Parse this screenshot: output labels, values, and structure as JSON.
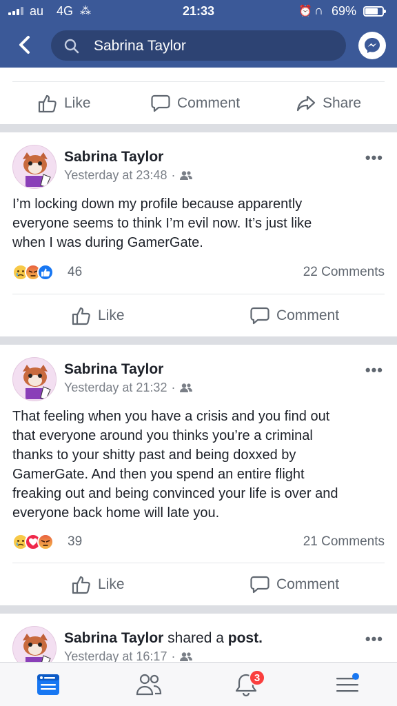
{
  "status_bar": {
    "carrier": "au",
    "network": "4G",
    "time": "21:33",
    "battery": "69%"
  },
  "nav": {
    "search_query": "Sabrina Taylor",
    "icons": [
      "back-chevron-icon",
      "search-icon",
      "messenger-icon"
    ]
  },
  "actions": {
    "like": "Like",
    "comment": "Comment",
    "share": "Share"
  },
  "posts": [
    {
      "author": "Sabrina Taylor",
      "timestamp": "Yesterday at 23:48",
      "text": "I’m locking down my profile because apparently\neveryone seems to think I’m evil now.  It’s just like\nwhen I was during GamerGate.",
      "reactions": [
        "sad",
        "angry",
        "like"
      ],
      "reaction_count": "46",
      "comments": "22 Comments"
    },
    {
      "author": "Sabrina Taylor",
      "timestamp": "Yesterday at 21:32",
      "text": "That feeling when you have a crisis and you find out\nthat everyone around you thinks you’re a criminal\nthanks to your shitty past and being doxxed by\nGamerGate.  And then you spend an entire flight\nfreaking out and being convinced your life is over and\neveryone back home will late you.",
      "reactions": [
        "sad",
        "love",
        "angry"
      ],
      "reaction_count": "39",
      "comments": "21 Comments"
    },
    {
      "author": "Sabrina Taylor",
      "shared_text": "shared a",
      "shared_object": "post.",
      "timestamp": "Yesterday at 16:17"
    }
  ],
  "tabbar": {
    "notifications_badge": "3",
    "tabs": [
      "news-feed-icon",
      "friends-icon",
      "notifications-bell-icon",
      "menu-icon"
    ]
  },
  "colors": {
    "brand": "#3b5998",
    "accent": "#1877f2",
    "badge": "#fa3e3e"
  }
}
